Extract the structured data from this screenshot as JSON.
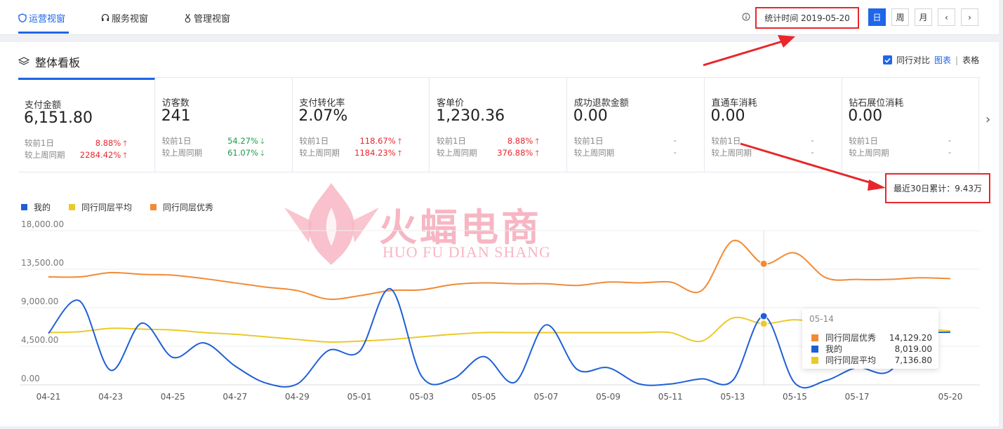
{
  "tabs": [
    {
      "label": "运营视窗",
      "icon": "shield-icon",
      "active": true
    },
    {
      "label": "服务视窗",
      "icon": "headset-icon",
      "active": false
    },
    {
      "label": "管理视窗",
      "icon": "medal-icon",
      "active": false
    }
  ],
  "header": {
    "stat_time": "统计时间 2019-05-20",
    "periods": [
      "日",
      "周",
      "月"
    ],
    "active_period": "日"
  },
  "panel": {
    "title": "整体看板",
    "compare_label": "同行对比",
    "view_chart": "图表",
    "view_sep": "|",
    "view_table": "表格"
  },
  "metrics": [
    {
      "label": "支付金额",
      "value": "6,151.80",
      "r1_label": "较前1日",
      "r1_value": "8.88%",
      "r1_dir": "up",
      "r2_label": "较上周同期",
      "r2_value": "2284.42%",
      "r2_dir": "up"
    },
    {
      "label": "访客数",
      "value": "241",
      "r1_label": "较前1日",
      "r1_value": "54.27%",
      "r1_dir": "down",
      "r2_label": "较上周同期",
      "r2_value": "61.07%",
      "r2_dir": "down"
    },
    {
      "label": "支付转化率",
      "value": "2.07%",
      "r1_label": "较前1日",
      "r1_value": "118.67%",
      "r1_dir": "up",
      "r2_label": "较上周同期",
      "r2_value": "1184.23%",
      "r2_dir": "up"
    },
    {
      "label": "客单价",
      "value": "1,230.36",
      "r1_label": "较前1日",
      "r1_value": "8.88%",
      "r1_dir": "up",
      "r2_label": "较上周同期",
      "r2_value": "376.88%",
      "r2_dir": "up"
    },
    {
      "label": "成功退款金额",
      "value": "0.00",
      "r1_label": "较前1日",
      "r1_value": "-",
      "r1_dir": "none",
      "r2_label": "较上周同期",
      "r2_value": "-",
      "r2_dir": "none"
    },
    {
      "label": "直通车消耗",
      "value": "0.00",
      "r1_label": "较前1日",
      "r1_value": "-",
      "r1_dir": "none",
      "r2_label": "较上周同期",
      "r2_value": "-",
      "r2_dir": "none"
    },
    {
      "label": "钻石展位消耗",
      "value": "0.00",
      "r1_label": "较前1日",
      "r1_value": "-",
      "r1_dir": "none",
      "r2_label": "较上周同期",
      "r2_value": "-",
      "r2_dir": "none"
    }
  ],
  "cumulative": "最近30日累计：9.43万",
  "watermark": {
    "brand": "火蝠电商",
    "pinyin": "HUO FU DIAN SHANG"
  },
  "colors": {
    "accent": "#1f66e8",
    "up": "#e8262b",
    "down": "#1c9b4b",
    "mine": "#1f5fd6",
    "avg": "#ecc92a",
    "best": "#f28a35",
    "annotation": "#e8262b"
  },
  "chart_data": {
    "type": "line",
    "x": [
      "04-21",
      "04-22",
      "04-23",
      "04-24",
      "04-25",
      "04-26",
      "04-27",
      "04-28",
      "04-29",
      "04-30",
      "05-01",
      "05-02",
      "05-03",
      "05-04",
      "05-05",
      "05-06",
      "05-07",
      "05-08",
      "05-09",
      "05-10",
      "05-11",
      "05-12",
      "05-13",
      "05-14",
      "05-15",
      "05-16",
      "05-17",
      "05-18",
      "05-19",
      "05-20"
    ],
    "x_tick_labels": [
      "04-21",
      "04-23",
      "04-25",
      "04-27",
      "04-29",
      "05-01",
      "05-03",
      "05-05",
      "05-07",
      "05-09",
      "05-11",
      "05-13",
      "05-15",
      "05-17",
      "05-20"
    ],
    "y_ticks": [
      "18,000.00",
      "13,500.00",
      "9,000.00",
      "4,500.00",
      "0.00"
    ],
    "ylim": [
      0,
      18000
    ],
    "grid": true,
    "series": [
      {
        "name": "我的",
        "color": "#1f5fd6",
        "values": [
          6000,
          9800,
          1700,
          7200,
          3200,
          4900,
          2200,
          200,
          100,
          4000,
          3900,
          11200,
          1000,
          700,
          3300,
          300,
          7000,
          1800,
          2000,
          100,
          100,
          700,
          500,
          8019,
          200,
          500,
          2000,
          1500,
          5600,
          6151.8
        ]
      },
      {
        "name": "同行同层平均",
        "color": "#ecc92a",
        "values": [
          6100,
          6200,
          6600,
          6500,
          6400,
          6100,
          5900,
          5600,
          5300,
          5000,
          5100,
          5300,
          5600,
          5900,
          6100,
          6100,
          6100,
          6100,
          6100,
          6100,
          6100,
          5100,
          7800,
          7136.8,
          7600,
          7100,
          6800,
          6600,
          6500,
          6300
        ]
      },
      {
        "name": "同行同层优秀",
        "color": "#f28a35",
        "values": [
          12600,
          12600,
          13100,
          12900,
          12800,
          12400,
          11900,
          11400,
          11000,
          10000,
          10400,
          11000,
          11100,
          11700,
          11900,
          11800,
          11800,
          11600,
          12000,
          11900,
          12000,
          11000,
          16800,
          14129.2,
          15400,
          12500,
          12300,
          12300,
          12500,
          12400
        ]
      }
    ],
    "tooltip": {
      "date": "05-14",
      "rows": [
        {
          "name": "同行同层优秀",
          "value": "14,129.20",
          "color": "#f28a35"
        },
        {
          "name": "我的",
          "value": "8,019.00",
          "color": "#1f5fd6"
        },
        {
          "name": "同行同层平均",
          "value": "7,136.80",
          "color": "#ecc92a"
        }
      ]
    }
  }
}
